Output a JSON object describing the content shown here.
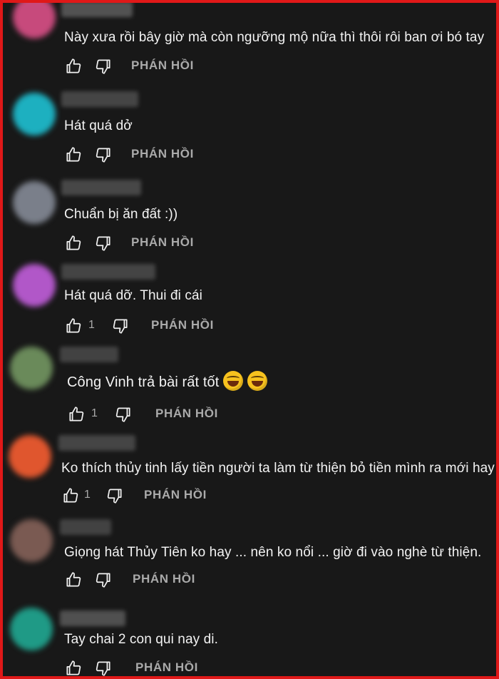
{
  "colors": {
    "background": "#181818",
    "border": "#e01818",
    "text": "#f1f1f1",
    "secondary": "#aaaaaa"
  },
  "reply_label": "PHÁN HỒI",
  "comments": [
    {
      "text": "Này xưa rồi bây giờ mà còn ngưỡng  mộ nữa thì thôi rôi ban ơi bó tay",
      "likes": "",
      "avatar_color": "#c74a7c"
    },
    {
      "text": "Hát quá dở",
      "likes": "",
      "avatar_color": "#1db0c0"
    },
    {
      "text": "Chuẩn bị ăn đất :))",
      "likes": "",
      "avatar_color": "#7a7f8a"
    },
    {
      "text": "Hát quá dỡ. Thui đi      cái",
      "likes": "1",
      "avatar_color": "#b157c8"
    },
    {
      "text": "Công Vinh trả bài rất tốt",
      "likes": "1",
      "avatar_color": "#6a8a5a",
      "emojis": [
        "rofl-emoji",
        "rofl-emoji"
      ]
    },
    {
      "text": "Ko thích thủy tinh lấy tiền người ta làm từ thiện bỏ tiền mình ra mới hay",
      "likes": "1",
      "avatar_color": "#e0562e"
    },
    {
      "text": "Giọng hát Thủy Tiên ko hay ... nên ko nổi ... giờ đi vào nghè từ thiện.",
      "likes": "",
      "avatar_color": "#7a5a52"
    },
    {
      "text": "Tay chai 2 con qui nay di.",
      "likes": "",
      "avatar_color": "#1f9a86"
    }
  ]
}
